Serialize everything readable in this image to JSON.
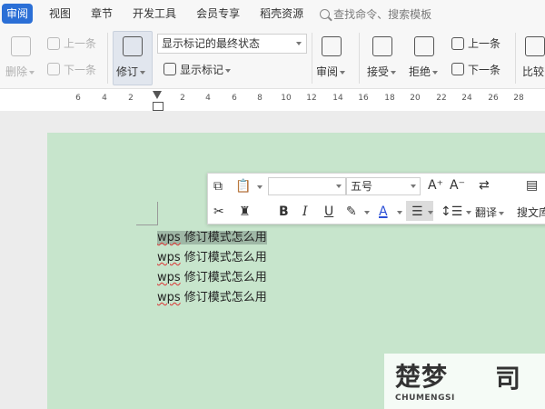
{
  "menu": {
    "tabs": [
      "审阅",
      "视图",
      "章节",
      "开发工具",
      "会员专享",
      "稻壳资源"
    ],
    "active_tab": "审阅",
    "search_placeholder": "查找命令、搜索模板"
  },
  "ribbon": {
    "delete_label": "删除",
    "prev_label_disabled": "上一条",
    "next_label_disabled": "下一条",
    "track_changes_label": "修订",
    "markup_mode_value": "显示标记的最终状态",
    "show_markup_label": "显示标记",
    "review_pane_label": "审阅",
    "accept_label": "接受",
    "reject_label": "拒绝",
    "prev_label": "上一条",
    "next_label": "下一条",
    "compare_label": "比较"
  },
  "ruler": {
    "ticks": [
      "6",
      "4",
      "2",
      "2",
      "4",
      "6",
      "8",
      "10",
      "12",
      "14",
      "16",
      "18",
      "20",
      "22",
      "24",
      "26",
      "28"
    ]
  },
  "mini_toolbar": {
    "font_size": "五号",
    "bold": "B",
    "italic": "I",
    "underline": "U",
    "font_color": "A",
    "translate_label": "翻译",
    "search_doc_label": "搜文库",
    "grow_font": "A⁺",
    "shrink_font": "A⁻"
  },
  "document": {
    "lines": [
      {
        "prefix": "wps",
        "text": " 修订模式怎么用"
      },
      {
        "prefix": "wps",
        "text": " 修订模式怎么用"
      },
      {
        "prefix": "wps",
        "text": " 修订模式怎么用"
      },
      {
        "prefix": "wps",
        "text": " 修订模式怎么用"
      }
    ]
  },
  "watermark": {
    "brand_cn": "楚梦",
    "brand_glyph": "司",
    "brand_en": "CHUMENGSI"
  },
  "colors": {
    "accent": "#2b6fd6",
    "page_bg": "#c7e5cc",
    "spell_underline": "#dd3333"
  }
}
